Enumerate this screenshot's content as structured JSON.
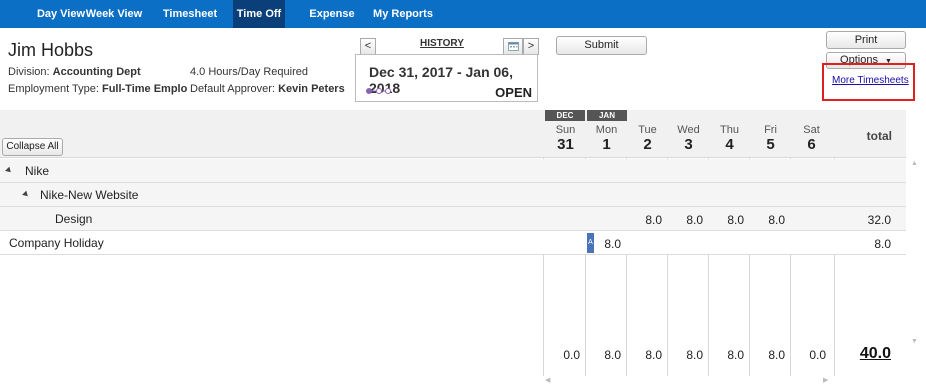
{
  "nav": {
    "tabs": [
      {
        "label": "Day View",
        "active": false
      },
      {
        "label": "Week View",
        "active": false
      },
      {
        "label": "Timesheet View",
        "active": false
      },
      {
        "label": "Time Off",
        "active": true
      },
      {
        "label": "Expense Sheets",
        "active": false
      },
      {
        "label": "My Reports",
        "active": false
      }
    ]
  },
  "employee": {
    "name": "Jim Hobbs",
    "division_label": "Division:",
    "division": "Accounting Dept",
    "employment_label": "Employment Type:",
    "employment": "Full-Time Emplo",
    "hours_required": "4.0 Hours/Day Required",
    "approver_label": "Default Approver:",
    "approver": "Kevin Peters"
  },
  "period": {
    "history_label": "HISTORY",
    "date_range": "Dec 31, 2017 - Jan 06, 2018",
    "status": "OPEN",
    "prev_glyph": "<",
    "next_glyph": ">"
  },
  "actions": {
    "submit": "Submit",
    "print": "Print",
    "options": "Options",
    "more_timesheets": "More Timesheets",
    "collapse_all": "Collapse All"
  },
  "grid": {
    "months": [
      "DEC",
      "JAN"
    ],
    "days": [
      {
        "dow": "Sun",
        "num": "31"
      },
      {
        "dow": "Mon",
        "num": "1"
      },
      {
        "dow": "Tue",
        "num": "2"
      },
      {
        "dow": "Wed",
        "num": "3"
      },
      {
        "dow": "Thu",
        "num": "4"
      },
      {
        "dow": "Fri",
        "num": "5"
      },
      {
        "dow": "Sat",
        "num": "6"
      }
    ],
    "total_header": "total",
    "rows": [
      {
        "label": "Nike",
        "hours": [
          "",
          "",
          "",
          "",
          "",
          "",
          ""
        ],
        "total": ""
      },
      {
        "label": "Nike-New Website",
        "hours": [
          "",
          "",
          "",
          "",
          "",
          "",
          ""
        ],
        "total": ""
      },
      {
        "label": "Design",
        "hours": [
          "",
          "",
          "8.0",
          "8.0",
          "8.0",
          "8.0",
          ""
        ],
        "total": "32.0"
      },
      {
        "label": "Company Holiday",
        "marker": "A",
        "hours": [
          "",
          "8.0",
          "",
          "",
          "",
          "",
          ""
        ],
        "total": "8.0"
      }
    ],
    "daily_totals": [
      "0.0",
      "8.0",
      "8.0",
      "8.0",
      "8.0",
      "8.0",
      "0.0"
    ],
    "grand_total": "40.0"
  },
  "colors": {
    "nav_bg": "#0b6fc5",
    "nav_active": "#0a3f7a",
    "highlight_box": "#e02020",
    "approval_marker": "#4a74b8"
  }
}
